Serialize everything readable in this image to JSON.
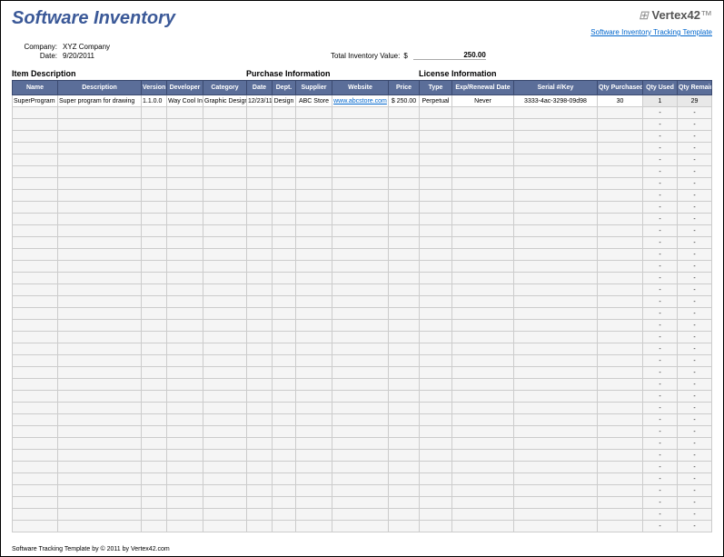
{
  "title": "Software Inventory",
  "brand_name": "Vertex42",
  "brand_link": "Software Inventory Tracking Template",
  "meta": {
    "company_label": "Company:",
    "company": "XYZ Company",
    "date_label": "Date:",
    "date": "9/20/2011"
  },
  "total": {
    "label": "Total Inventory Value:",
    "currency": "$",
    "value": "250.00"
  },
  "sections": {
    "item": "Item Description",
    "purchase": "Purchase Information",
    "license": "License Information"
  },
  "columns": [
    "Name",
    "Description",
    "Version",
    "Developer",
    "Category",
    "Date",
    "Dept.",
    "Supplier",
    "Website",
    "Price",
    "Type",
    "Exp/Renewal Date",
    "Serial #/Key",
    "Qty Purchased",
    "Qty Used",
    "Qty Remaining"
  ],
  "widths": [
    50,
    92,
    28,
    40,
    48,
    28,
    26,
    40,
    62,
    34,
    36,
    68,
    92,
    50,
    38,
    38
  ],
  "row": {
    "name": "SuperProgram",
    "desc": "Super program for drawing",
    "version": "1.1.0.0",
    "developer": "Way Cool Inc",
    "category": "Graphic Design",
    "date": "12/23/11",
    "dept": "Design",
    "supplier": "ABC Store",
    "website": "www.abcstore.com",
    "price": "$  250.00",
    "type": "Perpetual",
    "exp": "Never",
    "serial": "3333-4ac-3298-09d98",
    "qtyp": "30",
    "qtyu": "1",
    "qtyr": "29"
  },
  "dash": "-",
  "empty_rows": 36,
  "footer": "Software Tracking Template by © 2011 by Vertex42.com"
}
